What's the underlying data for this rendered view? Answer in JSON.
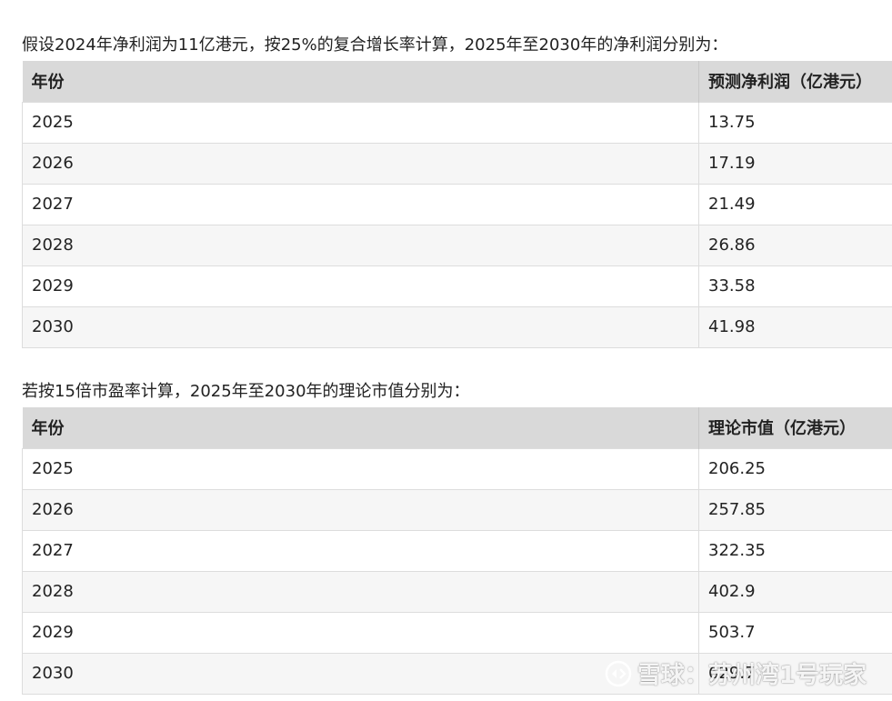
{
  "intro_text": "假设2024年净利润为11亿港元，按25%的复合增长率计算，2025年至2030年的净利润分别为：",
  "table1": {
    "headers": [
      "年份",
      "预测净利润（亿港元）"
    ],
    "rows": [
      [
        "2025",
        "13.75"
      ],
      [
        "2026",
        "17.19"
      ],
      [
        "2027",
        "21.49"
      ],
      [
        "2028",
        "26.86"
      ],
      [
        "2029",
        "33.58"
      ],
      [
        "2030",
        "41.98"
      ]
    ]
  },
  "mid_text": "若按15倍市盈率计算，2025年至2030年的理论市值分别为：",
  "table2": {
    "headers": [
      "年份",
      "理论市值（亿港元）"
    ],
    "rows": [
      [
        "2025",
        "206.25"
      ],
      [
        "2026",
        "257.85"
      ],
      [
        "2027",
        "322.35"
      ],
      [
        "2028",
        "402.9"
      ],
      [
        "2029",
        "503.7"
      ],
      [
        "2030",
        "629.7"
      ]
    ]
  },
  "watermark": {
    "text": "雪球：苏州湾1号玩家",
    "icon": "snowball-logo-icon"
  }
}
